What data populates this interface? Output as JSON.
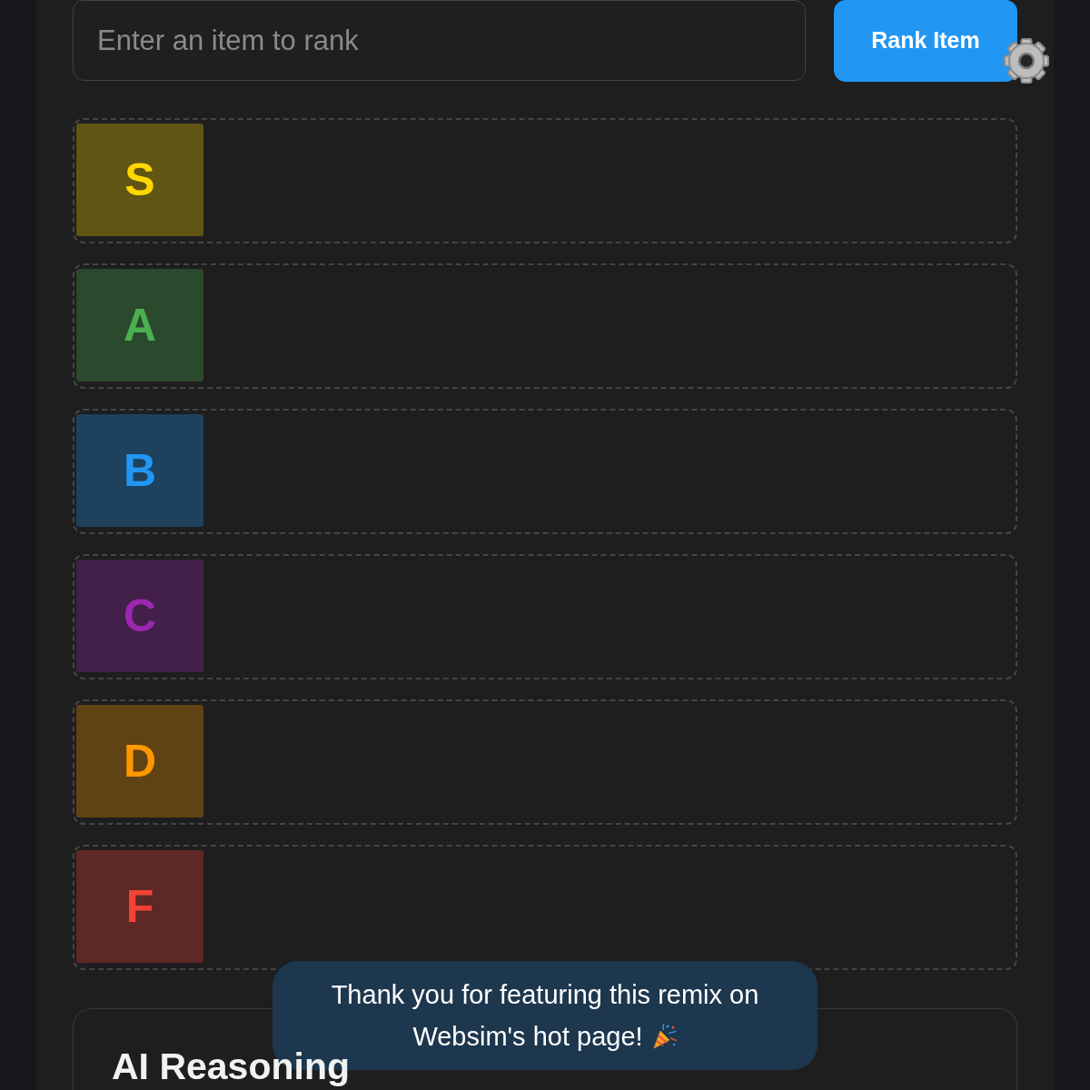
{
  "item_input": {
    "placeholder": "Enter an item to rank"
  },
  "rank_button": {
    "label": "Rank Item"
  },
  "tiers": [
    {
      "label": "S",
      "color": "#ffd700"
    },
    {
      "label": "A",
      "color": "#4caf50"
    },
    {
      "label": "B",
      "color": "#2196f3"
    },
    {
      "label": "C",
      "color": "#9c27b0"
    },
    {
      "label": "D",
      "color": "#ff9800"
    },
    {
      "label": "F",
      "color": "#f44336"
    }
  ],
  "reasoning_panel": {
    "title": "AI Reasoning"
  },
  "toast": {
    "message_lines": [
      "Thank you for featuring this remix on",
      "Websim's hot page!"
    ]
  }
}
